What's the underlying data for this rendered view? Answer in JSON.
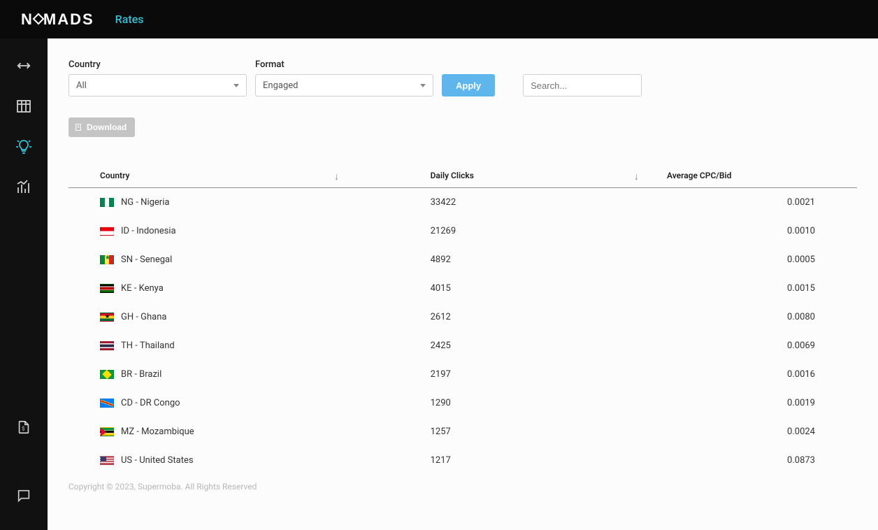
{
  "app": {
    "logo_text": "NOMADS",
    "page_title": "Rates"
  },
  "filters": {
    "country_label": "Country",
    "country_value": "All",
    "format_label": "Format",
    "format_value": "Engaged",
    "apply_label": "Apply",
    "search_placeholder": "Search..."
  },
  "actions": {
    "download_label": "Download"
  },
  "table": {
    "headers": {
      "country": "Country",
      "clicks": "Daily Clicks",
      "cpc": "Average CPC/Bid"
    },
    "rows": [
      {
        "flag": "ng",
        "country": "NG - Nigeria",
        "clicks": "33422",
        "cpc": "0.0021"
      },
      {
        "flag": "id",
        "country": "ID - Indonesia",
        "clicks": "21269",
        "cpc": "0.0010"
      },
      {
        "flag": "sn",
        "country": "SN - Senegal",
        "clicks": "4892",
        "cpc": "0.0005"
      },
      {
        "flag": "ke",
        "country": "KE - Kenya",
        "clicks": "4015",
        "cpc": "0.0015"
      },
      {
        "flag": "gh",
        "country": "GH - Ghana",
        "clicks": "2612",
        "cpc": "0.0080"
      },
      {
        "flag": "th",
        "country": "TH - Thailand",
        "clicks": "2425",
        "cpc": "0.0069"
      },
      {
        "flag": "br",
        "country": "BR - Brazil",
        "clicks": "2197",
        "cpc": "0.0016"
      },
      {
        "flag": "cd",
        "country": "CD - DR Congo",
        "clicks": "1290",
        "cpc": "0.0019"
      },
      {
        "flag": "mz",
        "country": "MZ - Mozambique",
        "clicks": "1257",
        "cpc": "0.0024"
      },
      {
        "flag": "us",
        "country": "US - United States",
        "clicks": "1217",
        "cpc": "0.0873"
      }
    ]
  },
  "footer": "Copyright © 2023, Supermoba. All Rights Reserved"
}
